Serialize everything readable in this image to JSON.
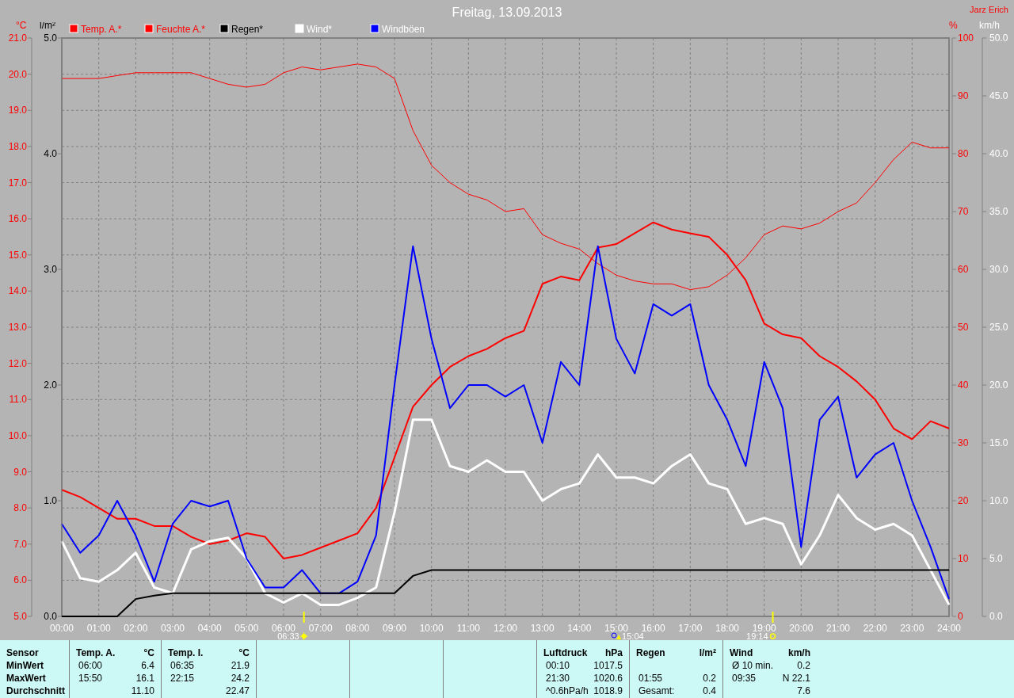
{
  "header": {
    "title": "Freitag, 13.09.2013",
    "author": "Jarz Erich"
  },
  "chart_data": {
    "type": "line",
    "grid": true,
    "legend": "top",
    "x": [
      0,
      0.5,
      1,
      1.5,
      2,
      2.5,
      3,
      3.5,
      4,
      4.5,
      5,
      5.5,
      6,
      6.5,
      7,
      7.5,
      8,
      8.5,
      9,
      9.5,
      10,
      10.5,
      11,
      11.5,
      12,
      12.5,
      13,
      13.5,
      14,
      14.5,
      15,
      15.5,
      16,
      16.5,
      17,
      17.5,
      18,
      18.5,
      19,
      19.5,
      20,
      20.5,
      21,
      21.5,
      22,
      22.5,
      23,
      23.5,
      24
    ],
    "xticks": [
      {
        "value": 0,
        "label": "00:00"
      },
      {
        "value": 1,
        "label": "01:00"
      },
      {
        "value": 2,
        "label": "02:00"
      },
      {
        "value": 3,
        "label": "03:00"
      },
      {
        "value": 4,
        "label": "04:00"
      },
      {
        "value": 5,
        "label": "05:00"
      },
      {
        "value": 6,
        "label": "06:00"
      },
      {
        "value": 7,
        "label": "07:00"
      },
      {
        "value": 8,
        "label": "08:00"
      },
      {
        "value": 9,
        "label": "09:00"
      },
      {
        "value": 10,
        "label": "10:00"
      },
      {
        "value": 11,
        "label": "11:00"
      },
      {
        "value": 12,
        "label": "12:00"
      },
      {
        "value": 13,
        "label": "13:00"
      },
      {
        "value": 14,
        "label": "14:00"
      },
      {
        "value": 15,
        "label": "15:00"
      },
      {
        "value": 16,
        "label": "16:00"
      },
      {
        "value": 17,
        "label": "17:00"
      },
      {
        "value": 18,
        "label": "18:00"
      },
      {
        "value": 19,
        "label": "19:00"
      },
      {
        "value": 20,
        "label": "20:00"
      },
      {
        "value": 21,
        "label": "21:00"
      },
      {
        "value": 22,
        "label": "22:00"
      },
      {
        "value": 23,
        "label": "23:00"
      },
      {
        "value": 24,
        "label": "24:00"
      }
    ],
    "xlim": [
      0,
      24
    ],
    "ylabel": "°C",
    "ylim": [
      5,
      21
    ],
    "yticks": [
      {
        "value": 5,
        "label": "5.0"
      },
      {
        "value": 6,
        "label": "6.0"
      },
      {
        "value": 7,
        "label": "7.0"
      },
      {
        "value": 8,
        "label": "8.0"
      },
      {
        "value": 9,
        "label": "9.0"
      },
      {
        "value": 10,
        "label": "10.0"
      },
      {
        "value": 11,
        "label": "11.0"
      },
      {
        "value": 12,
        "label": "12.0"
      },
      {
        "value": 13,
        "label": "13.0"
      },
      {
        "value": 14,
        "label": "14.0"
      },
      {
        "value": 15,
        "label": "15.0"
      },
      {
        "value": 16,
        "label": "16.0"
      },
      {
        "value": 17,
        "label": "17.0"
      },
      {
        "value": 18,
        "label": "18.0"
      },
      {
        "value": 19,
        "label": "19.0"
      },
      {
        "value": 20,
        "label": "20.0"
      },
      {
        "value": 21,
        "label": "21.0"
      }
    ],
    "y2label": "%",
    "y2lim": [
      0,
      100
    ],
    "y2ticks": [
      0,
      10,
      20,
      30,
      40,
      50,
      60,
      70,
      80,
      90,
      100
    ],
    "y3label": "km/h",
    "y3lim": [
      0,
      50
    ],
    "y3ticks": [
      {
        "value": 0,
        "label": "0.0"
      },
      {
        "value": 5,
        "label": "5.0"
      },
      {
        "value": 10,
        "label": "10.0"
      },
      {
        "value": 15,
        "label": "15.0"
      },
      {
        "value": 20,
        "label": "20.0"
      },
      {
        "value": 25,
        "label": "25.0"
      },
      {
        "value": 30,
        "label": "30.0"
      },
      {
        "value": 35,
        "label": "35.0"
      },
      {
        "value": 40,
        "label": "40.0"
      },
      {
        "value": 45,
        "label": "45.0"
      },
      {
        "value": 50,
        "label": "50.0"
      }
    ],
    "series": [
      {
        "name": "Temp. A.*",
        "color": "#ff0000",
        "values": [
          8.5,
          8.3,
          8.0,
          7.7,
          7.7,
          7.5,
          7.5,
          7.2,
          7.0,
          7.1,
          7.3,
          7.2,
          6.6,
          6.7,
          6.9,
          7.1,
          7.3,
          8.0,
          9.4,
          10.8,
          11.4,
          11.9,
          12.2,
          12.4,
          12.7,
          12.9,
          14.2,
          14.4,
          14.3,
          15.2,
          15.3,
          15.6,
          15.9,
          15.7,
          15.6,
          15.5,
          15.0,
          14.3,
          13.1,
          12.8,
          12.7,
          12.2,
          11.9,
          11.5,
          11.0,
          10.2,
          9.9,
          10.4,
          10.2
        ]
      },
      {
        "name": "Feuchte A.*",
        "color": "#ff0000",
        "axis": "y2",
        "values": [
          93,
          93,
          93,
          93.5,
          94,
          94,
          94,
          94,
          93,
          92,
          91.5,
          92,
          94,
          95,
          94.5,
          95,
          95.5,
          95,
          93,
          84,
          78,
          75,
          73,
          72,
          70,
          70.5,
          66,
          64.5,
          63.5,
          61,
          59,
          58,
          57.5,
          57.5,
          56.5,
          57,
          59,
          62,
          66,
          67.5,
          67,
          68,
          70,
          71.5,
          75,
          79,
          82,
          81,
          81
        ]
      },
      {
        "name": "Wind*",
        "color": "#ffffff",
        "axis": "y3",
        "values": [
          6.5,
          3.3,
          3.0,
          4.0,
          5.5,
          2.5,
          2.0,
          5.8,
          6.5,
          6.8,
          5.0,
          2.0,
          1.2,
          2.0,
          1.0,
          1.0,
          1.6,
          2.5,
          9.0,
          17.0,
          17.0,
          13.0,
          12.5,
          13.5,
          12.5,
          12.5,
          10.0,
          11.0,
          11.5,
          14.0,
          12.0,
          12.0,
          11.5,
          13.0,
          14.0,
          11.5,
          11.0,
          8.0,
          8.5,
          8.0,
          4.5,
          7.0,
          10.5,
          8.5,
          7.5,
          8.0,
          7.0,
          4.0,
          1.0
        ]
      },
      {
        "name": "Windböen",
        "color": "#0000ff",
        "axis": "y3",
        "values": [
          8,
          5.5,
          7,
          10,
          7,
          3,
          8,
          10,
          9.5,
          10,
          5,
          2.5,
          2.5,
          4,
          2,
          2,
          3,
          7,
          20,
          32,
          24,
          18,
          20,
          20,
          19,
          20,
          15,
          22,
          20,
          32,
          24,
          21,
          27,
          26,
          27,
          20,
          17,
          13,
          22,
          18,
          6,
          17,
          19,
          12,
          14,
          15,
          10,
          6,
          1.5
        ]
      }
    ],
    "annotations": [
      "06:33",
      "15:04",
      "19:14"
    ]
  },
  "rain_chart": {
    "chart_data": {
      "type": "line",
      "x": [
        0,
        0.5,
        1,
        1.5,
        2,
        2.5,
        3,
        3.5,
        4,
        4.5,
        5,
        5.5,
        6,
        6.5,
        7,
        7.5,
        8,
        8.5,
        9,
        9.5,
        10,
        10.5,
        11,
        11.5,
        12,
        12.5,
        13,
        13.5,
        14,
        14.5,
        15,
        15.5,
        16,
        16.5,
        17,
        17.5,
        18,
        18.5,
        19,
        19.5,
        20,
        20.5,
        21,
        21.5,
        22,
        22.5,
        23,
        23.5,
        24
      ],
      "xlim": [
        0,
        24
      ],
      "ylabel": "l/m²",
      "ylim": [
        0,
        5
      ],
      "yticks": [
        {
          "value": 0,
          "label": "0.0"
        },
        {
          "value": 1,
          "label": "1.0"
        },
        {
          "value": 2,
          "label": "2.0"
        },
        {
          "value": 3,
          "label": "3.0"
        },
        {
          "value": 4,
          "label": "4.0"
        },
        {
          "value": 5,
          "label": "5.0"
        }
      ],
      "series": [
        {
          "name": "Regen*",
          "color": "#000000",
          "values": [
            0,
            0,
            0,
            0,
            0.15,
            0.18,
            0.2,
            0.2,
            0.2,
            0.2,
            0.2,
            0.2,
            0.2,
            0.2,
            0.2,
            0.2,
            0.2,
            0.2,
            0.2,
            0.35,
            0.4,
            0.4,
            0.4,
            0.4,
            0.4,
            0.4,
            0.4,
            0.4,
            0.4,
            0.4,
            0.4,
            0.4,
            0.4,
            0.4,
            0.4,
            0.4,
            0.4,
            0.4,
            0.4,
            0.4,
            0.4,
            0.4,
            0.4,
            0.4,
            0.4,
            0.4,
            0.4,
            0.4,
            0.4
          ]
        }
      ]
    }
  },
  "stats": {
    "header": "Sensor",
    "row_labels": [
      "MinWert",
      "MaxWert",
      "Durchschnitt"
    ],
    "groups": [
      {
        "kind": "data",
        "title": "Temp. A.",
        "unit": "°C",
        "rows": [
          {
            "label": "06:00",
            "value": "6.4"
          },
          {
            "label": "15:50",
            "value": "16.1"
          },
          {
            "value": "11.10"
          }
        ]
      },
      {
        "kind": "data",
        "title": "Temp. I.",
        "unit": "°C",
        "rows": [
          {
            "label": "06:35",
            "value": "21.9"
          },
          {
            "label": "22:15",
            "value": "24.2"
          },
          {
            "value": "22.47"
          }
        ]
      },
      {
        "kind": "blank"
      },
      {
        "kind": "blank"
      },
      {
        "kind": "blank"
      },
      {
        "kind": "data",
        "title": "Luftdruck",
        "unit": "hPa",
        "rows": [
          {
            "label": "00:10",
            "value": "1017.5"
          },
          {
            "label": "21:30",
            "value": "1020.6"
          },
          {
            "label": "^0.6hPa/h",
            "value": "1018.9"
          }
        ]
      },
      {
        "kind": "data",
        "title": "Regen",
        "unit": "l/m²",
        "rows": [
          {},
          {
            "label": "01:55",
            "value": "0.2"
          },
          {
            "label": "Gesamt:",
            "value": "0.4"
          }
        ]
      },
      {
        "kind": "data",
        "title": "Wind",
        "unit": "km/h",
        "rows": [
          {
            "label": "Ø 10 min.",
            "value": "0.2"
          },
          {
            "label": "09:35",
            "value": "N 22.1"
          },
          {
            "value": "7.6"
          }
        ]
      }
    ]
  }
}
